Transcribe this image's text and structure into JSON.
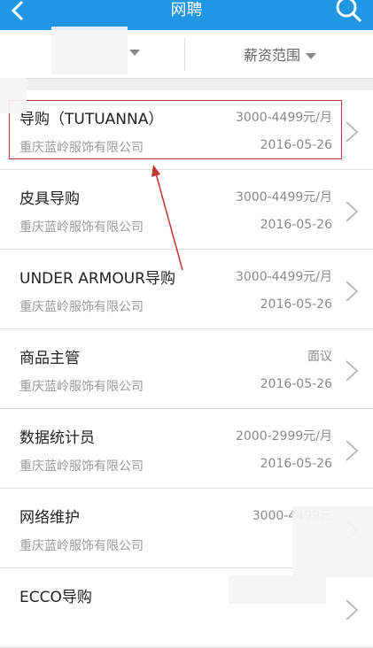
{
  "header": {
    "title": "网聘"
  },
  "filters": {
    "first_label": "",
    "salary_label": "薪资范围"
  },
  "jobs": [
    {
      "title": "导购（TUTUANNA）",
      "salary": "3000-4499元/月",
      "company": "重庆蓝岭服饰有限公司",
      "date": "2016-05-26"
    },
    {
      "title": "皮具导购",
      "salary": "3000-4499元/月",
      "company": "重庆蓝岭服饰有限公司",
      "date": "2016-05-26"
    },
    {
      "title": "UNDER ARMOUR导购",
      "salary": "3000-4499元/月",
      "company": "重庆蓝岭服饰有限公司",
      "date": "2016-05-26"
    },
    {
      "title": "商品主管",
      "salary": "面议",
      "company": "重庆蓝岭服饰有限公司",
      "date": "2016-05-26"
    },
    {
      "title": "数据统计员",
      "salary": "2000-2999元/月",
      "company": "重庆蓝岭服饰有限公司",
      "date": "2016-05-26"
    },
    {
      "title": "网络维护",
      "salary": "3000-4499元",
      "company": "重庆蓝岭服饰有限公司",
      "date": ""
    },
    {
      "title": "ECCO导购",
      "salary": "",
      "company": "",
      "date": ""
    }
  ],
  "colors": {
    "header": "#2196e3",
    "annotation": "#c0352f"
  }
}
